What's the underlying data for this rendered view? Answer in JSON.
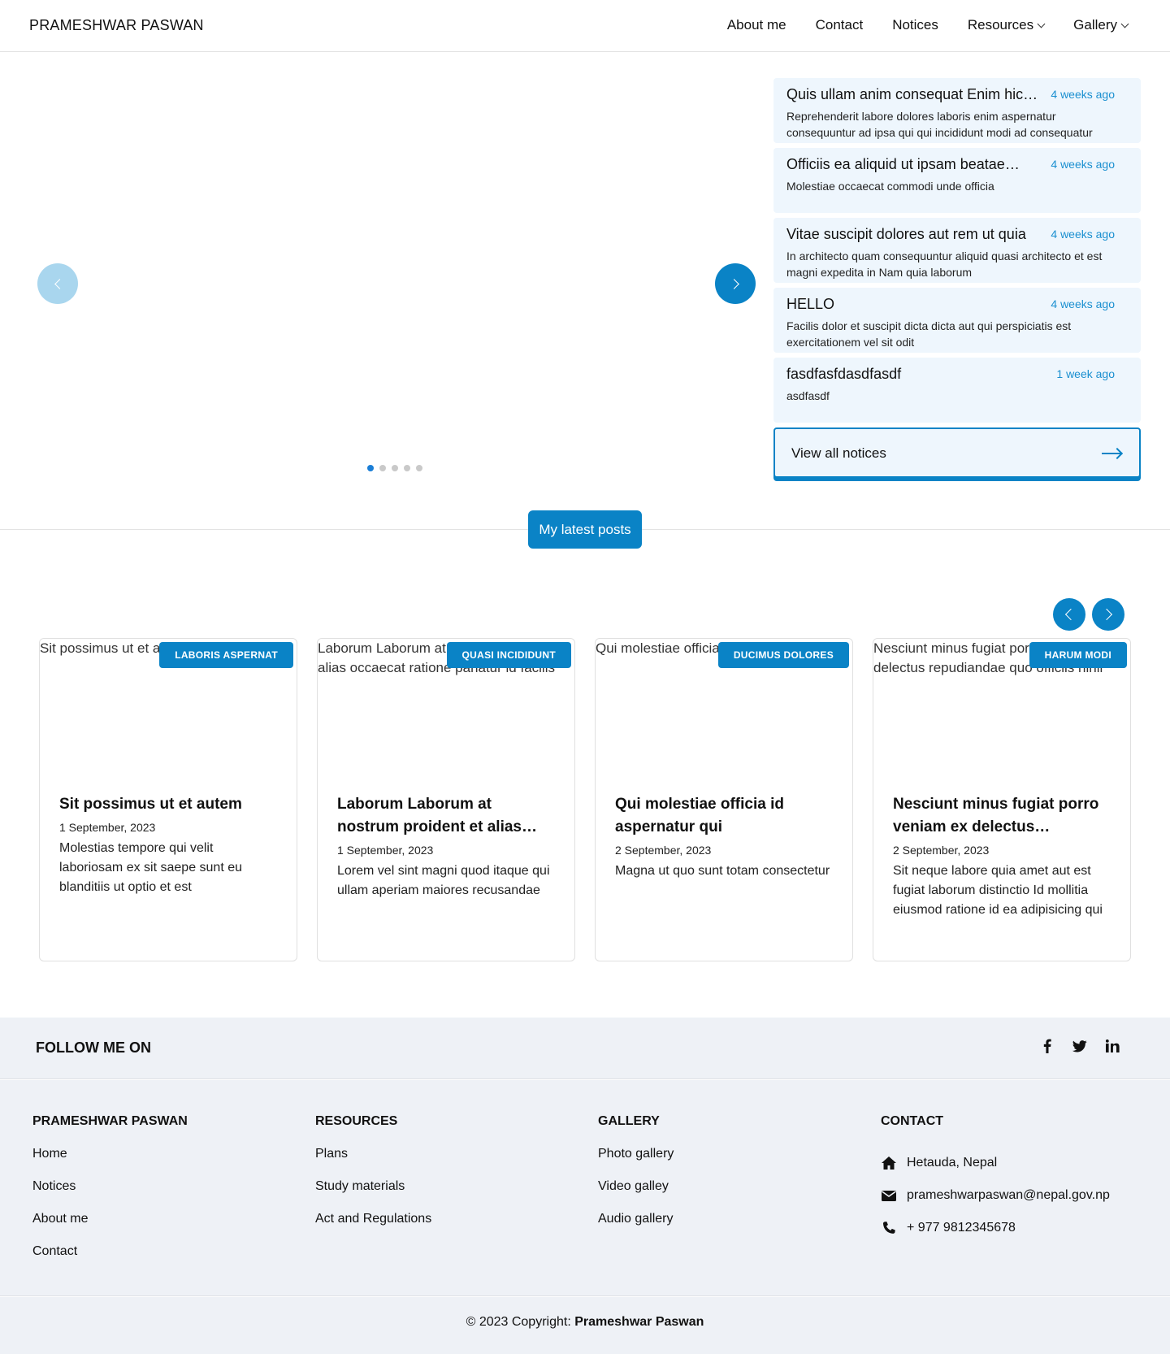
{
  "header": {
    "brand": "PRAMESHWAR PASWAN",
    "nav": [
      "About me",
      "Contact",
      "Notices",
      "Resources",
      "Gallery"
    ]
  },
  "notices": [
    {
      "title": "Quis ullam anim consequat Enim hic…",
      "time": "4 weeks ago",
      "body": "Reprehenderit labore dolores laboris enim aspernatur consequuntur ad ipsa qui qui incididunt modi ad consequatur pariatur Consectetur"
    },
    {
      "title": "Officiis ea aliquid ut ipsam beatae…",
      "time": "4 weeks ago",
      "body": "Molestiae occaecat commodi unde officia"
    },
    {
      "title": "Vitae suscipit dolores aut rem ut quia",
      "time": "4 weeks ago",
      "body": "In architecto quam consequuntur aliquid quasi architecto et est magni expedita in Nam quia laborum"
    },
    {
      "title": "HELLO",
      "time": "4 weeks ago",
      "body": "Facilis dolor et suscipit dicta dicta aut qui perspiciatis est exercitationem vel sit odit"
    },
    {
      "title": "fasdfasfdasdfasdf",
      "time": "1 week ago",
      "body": "asdfasdf"
    }
  ],
  "view_all": "View all notices",
  "latest_posts": "My latest posts",
  "posts": [
    {
      "img_alt": "Sit possimus ut et autem",
      "badge": "Laboris aspernat",
      "title": "Sit possimus ut et autem",
      "date": "1 September, 2023",
      "text": "Molestias tempore qui velit laboriosam ex sit saepe sunt eu blanditiis ut optio et est"
    },
    {
      "img_alt": "Laborum Laborum at nostrum proident et alias occaecat ratione pariatur id facilis",
      "badge": "Quasi incididunt",
      "title": "Laborum Laborum at nostrum proident et alias occaecat…",
      "date": "1 September, 2023",
      "text": "Lorem vel sint magni quod itaque qui ullam aperiam maiores recusandae"
    },
    {
      "img_alt": "Qui molestiae officia id aspernatur qui",
      "badge": "Ducimus dolores",
      "title": "Qui molestiae officia id aspernatur qui",
      "date": "2 September, 2023",
      "text": "Magna ut quo sunt totam consectetur"
    },
    {
      "img_alt": "Nesciunt minus fugiat porro veniam ex delectus repudiandae quo officiis nihil",
      "badge": "Harum modi",
      "title": "Nesciunt minus fugiat porro veniam ex delectus repudianda…",
      "date": "2 September, 2023",
      "text": "Sit neque labore quia amet aut est fugiat laborum distinctio Id mollitia eiusmod ratione id ea adipisicing qui"
    }
  ],
  "follow": {
    "label": "FOLLOW ME ON",
    "icons": [
      "facebook-icon",
      "twitter-icon",
      "linkedin-icon"
    ]
  },
  "footer": {
    "col1": {
      "title": "PRAMESHWAR PASWAN",
      "links": [
        "Home",
        "Notices",
        "About me",
        "Contact"
      ]
    },
    "col2": {
      "title": "RESOURCES",
      "links": [
        "Plans",
        "Study materials",
        "Act and Regulations"
      ]
    },
    "col3": {
      "title": "GALLERY",
      "links": [
        "Photo gallery",
        "Video galley",
        "Audio gallery"
      ]
    },
    "col4": {
      "title": "CONTACT",
      "address": "Hetauda, Nepal",
      "email": "prameshwarpaswan@nepal.gov.np",
      "phone": "+ 977 9812345678"
    }
  },
  "copyright": {
    "prefix": "© 2023 Copyright: ",
    "name": "Prameshwar Paswan"
  },
  "colors": {
    "accent": "#0a83c6",
    "notice_bg": "#eef6fd",
    "footer_bg": "#eef1f6"
  }
}
